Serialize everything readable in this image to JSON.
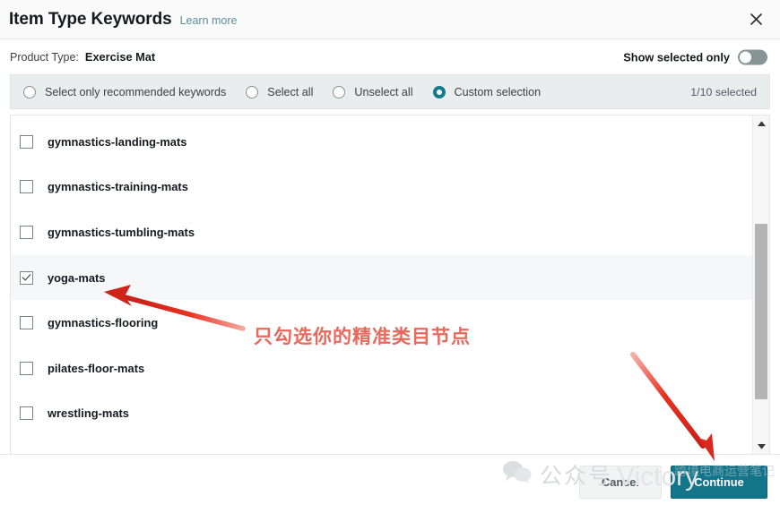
{
  "header": {
    "title": "Item Type Keywords",
    "learn_more": "Learn more",
    "close_icon": "close-icon"
  },
  "product_type": {
    "label": "Product Type:",
    "value": "Exercise Mat",
    "show_selected_only_label": "Show selected only",
    "toggle_state": "off"
  },
  "options_bar": {
    "radios": [
      {
        "label": "Select only recommended keywords",
        "checked": false
      },
      {
        "label": "Select all",
        "checked": false
      },
      {
        "label": "Unselect all",
        "checked": false
      },
      {
        "label": "Custom selection",
        "checked": true
      }
    ],
    "selected_count": "1/10 selected",
    "accent_color": "#127b8e"
  },
  "keyword_list": {
    "items": [
      {
        "label": "gymnastics-landing-mats",
        "checked": false
      },
      {
        "label": "gymnastics-training-mats",
        "checked": false
      },
      {
        "label": "gymnastics-tumbling-mats",
        "checked": false
      },
      {
        "label": "yoga-mats",
        "checked": true
      },
      {
        "label": "gymnastics-flooring",
        "checked": false
      },
      {
        "label": "pilates-floor-mats",
        "checked": false
      },
      {
        "label": "wrestling-mats",
        "checked": false
      }
    ],
    "scrollbar": {
      "up_arrow_icon": "chevron-up-icon",
      "down_arrow_icon": "chevron-down-icon"
    }
  },
  "footer": {
    "cancel_label": "Cancel",
    "continue_label": "Continue",
    "continue_color": "#13758a"
  },
  "annotations": {
    "note_text": "只勾选你的精准类目节点",
    "note_color": "#e8685d",
    "arrow_color": "#e03127"
  },
  "watermark": {
    "wechat_icon": "wechat-icon",
    "gzh_text": "公众号",
    "brand_text": "Victory",
    "cn_text": "跨境电商运营笔记"
  }
}
